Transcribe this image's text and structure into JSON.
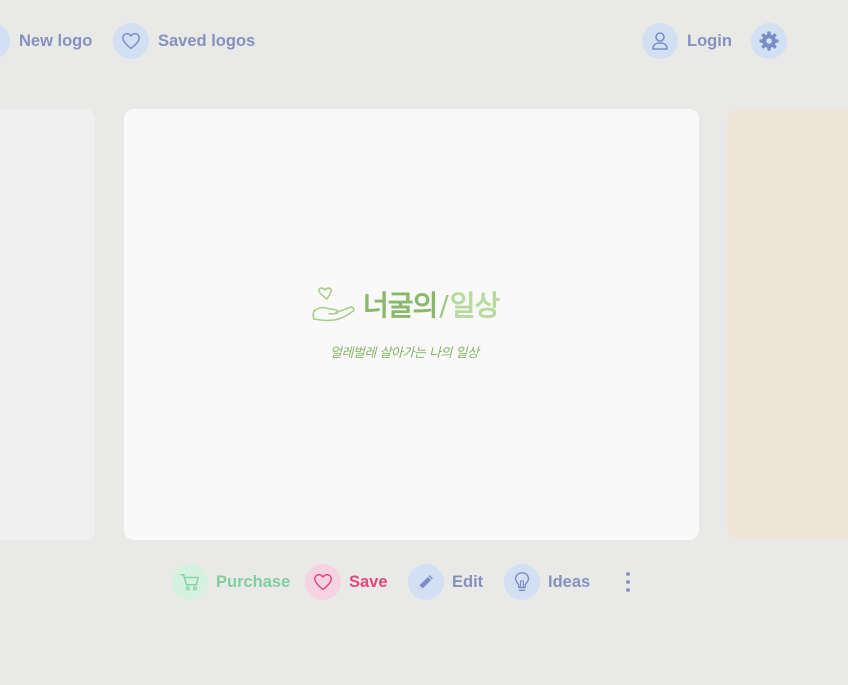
{
  "nav": {
    "new_logo": "New logo",
    "saved_logos": "Saved logos",
    "login": "Login"
  },
  "logo": {
    "title_part1": "너굴의",
    "separator": "/",
    "title_part2": "일상",
    "subtitle": "얼레벌레 살아가는 나의 일상"
  },
  "actions": {
    "purchase": "Purchase",
    "save": "Save",
    "edit": "Edit",
    "ideas": "Ideas"
  },
  "colors": {
    "background": "#e9e9e8",
    "nav_text": "#8492bd",
    "purchase": "#7fcf9f",
    "save": "#e5457f",
    "logo_green": "#8ab86a"
  },
  "icons": {
    "new_logo": "plus-icon",
    "saved_logos": "heart-icon",
    "login": "user-icon",
    "settings": "gear-icon",
    "purchase": "cart-icon",
    "save": "heart-icon",
    "edit": "pencil-icon",
    "ideas": "lightbulb-icon",
    "more": "more-vertical-icon"
  }
}
